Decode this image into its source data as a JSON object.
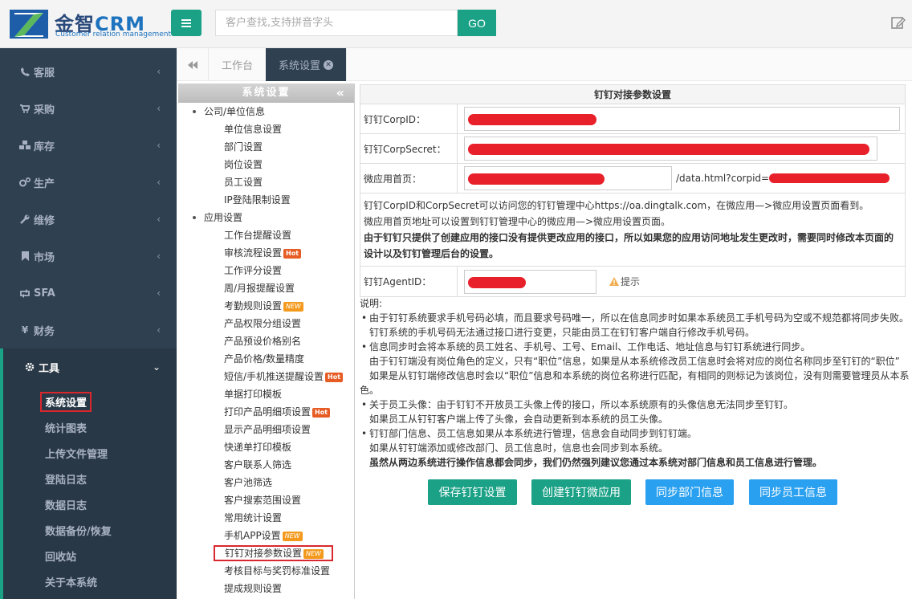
{
  "header": {
    "logo_title": "金智",
    "logo_crm": "CRM",
    "logo_subtitle": "Customer relation management",
    "search_placeholder": "客户查找,支持拼音字头",
    "go_label": "GO"
  },
  "sidebar": {
    "items": [
      {
        "label": "客服",
        "icon": "phone-icon"
      },
      {
        "label": "采购",
        "icon": "cart-icon"
      },
      {
        "label": "库存",
        "icon": "cubes-icon"
      },
      {
        "label": "生产",
        "icon": "gears-icon"
      },
      {
        "label": "维修",
        "icon": "wrench-icon"
      },
      {
        "label": "市场",
        "icon": "bookmark-icon"
      },
      {
        "label": "SFA",
        "icon": "retweet-icon"
      },
      {
        "label": "财务",
        "icon": "yen-icon"
      }
    ],
    "active": {
      "label": "工具",
      "icon": "gear-icon"
    },
    "sub_items": [
      "系统设置",
      "统计图表",
      "上传文件管理",
      "登陆日志",
      "数据日志",
      "数据备份/恢复",
      "回收站",
      "关于本系统"
    ]
  },
  "tabs": {
    "items": [
      "工作台",
      "系统设置"
    ]
  },
  "tree": {
    "title": "系统设置",
    "group1": "公司/单位信息",
    "group1_items": [
      "单位信息设置",
      "部门设置",
      "岗位设置",
      "员工设置",
      "IP登陆限制设置"
    ],
    "group2": "应用设置",
    "group2_items": [
      {
        "label": "工作台提醒设置",
        "badge": ""
      },
      {
        "label": "审核流程设置",
        "badge": "Hot"
      },
      {
        "label": "工作评分设置",
        "badge": ""
      },
      {
        "label": "周/月报提醒设置",
        "badge": ""
      },
      {
        "label": "考勤规则设置",
        "badge": "NEW"
      },
      {
        "label": "产品权限分组设置",
        "badge": ""
      },
      {
        "label": "产品预设价格别名",
        "badge": ""
      },
      {
        "label": "产品价格/数量精度",
        "badge": ""
      },
      {
        "label": "短信/手机推送提醒设置",
        "badge": "Hot"
      },
      {
        "label": "单据打印模板",
        "badge": ""
      },
      {
        "label": "打印产品明细项设置",
        "badge": "Hot"
      },
      {
        "label": "显示产品明细项设置",
        "badge": ""
      },
      {
        "label": "快递单打印模板",
        "badge": ""
      },
      {
        "label": "客户联系人筛选",
        "badge": ""
      },
      {
        "label": "客户池筛选",
        "badge": ""
      },
      {
        "label": "客户搜索范围设置",
        "badge": ""
      },
      {
        "label": "常用统计设置",
        "badge": ""
      },
      {
        "label": "手机APP设置",
        "badge": "NEW"
      },
      {
        "label": "钉钉对接参数设置",
        "badge": "NEW"
      },
      {
        "label": "考核目标与奖罚标准设置",
        "badge": ""
      },
      {
        "label": "提成规则设置",
        "badge": ""
      }
    ]
  },
  "form": {
    "title": "钉钉对接参数设置",
    "corpid_label": "钉钉CorpID：",
    "corpsecret_label": "钉钉CorpSecret：",
    "homepage_label": "微应用首页：",
    "homepage_suffix": "/data.html?corpid=",
    "note_line1": "钉钉CorpID和CorpSecret可以访问您的钉钉管理中心https://oa.dingtalk.com，在微应用—>微应用设置页面看到。",
    "note_line2": "微应用首页地址可以设置到钉钉管理中心的微应用—>微应用设置页面。",
    "note_bold": "由于钉钉只提供了创建应用的接口没有提供更改应用的接口，所以如果您的应用访问地址发生更改时，需要同时修改本页面的设计以及钉钉管理后台的设置。",
    "agentid_label": "钉钉AgentID：",
    "tip_label": "提示"
  },
  "explain": {
    "title": "说明:",
    "b1": "由于钉钉系统要求手机号码必填，而且要求号码唯一，所以在信息同步时如果本系统员工手机号码为空或不规范都将同步失败。",
    "b1_cont": "钉钉系统的手机号码无法通过接口进行变更，只能由员工在钉钉客户端自行修改手机号码。",
    "b2": "信息同步时会将本系统的员工姓名、手机号、工号、Email、工作电话、地址信息与钉钉系统进行同步。",
    "b2_cont1": "由于钉钉端没有岗位角色的定义，只有“职位”信息，如果是从本系统修改员工信息时会将对应的岗位名称同步至钉钉的“职位”",
    "b2_cont2": "如果是从钉钉端修改信息时会以“职位”信息和本系统的岗位名称进行匹配，有相同的则标记为该岗位，没有则需要管理员从本系",
    "b2_cont3": "色。",
    "b3": "关于员工头像：由于钉钉不开放员工头像上传的接口，所以本系统原有的头像信息无法同步至钉钉。",
    "b3_cont": "如果员工从钉钉客户端上传了头像，会自动更新到本系统的员工头像。",
    "b4": "钉钉部门信息、员工信息如果从本系统进行管理，信息会自动同步到钉钉端。",
    "b4_cont": "如果从钉钉端添加或修改部门、员工信息时，信息也会同步到本系统。",
    "b4_bold": "虽然从两边系统进行操作信息都会同步，我们仍然强列建议您通过本系统对部门信息和员工信息进行管理。"
  },
  "buttons": {
    "save": "保存钉钉设置",
    "create": "创建钉钉微应用",
    "sync_dept": "同步部门信息",
    "sync_staff": "同步员工信息"
  },
  "colors": {
    "accent": "#1aa186",
    "sidebar": "#2f4050",
    "blue_button": "#2aa0f0",
    "highlight": "#d9272e"
  }
}
